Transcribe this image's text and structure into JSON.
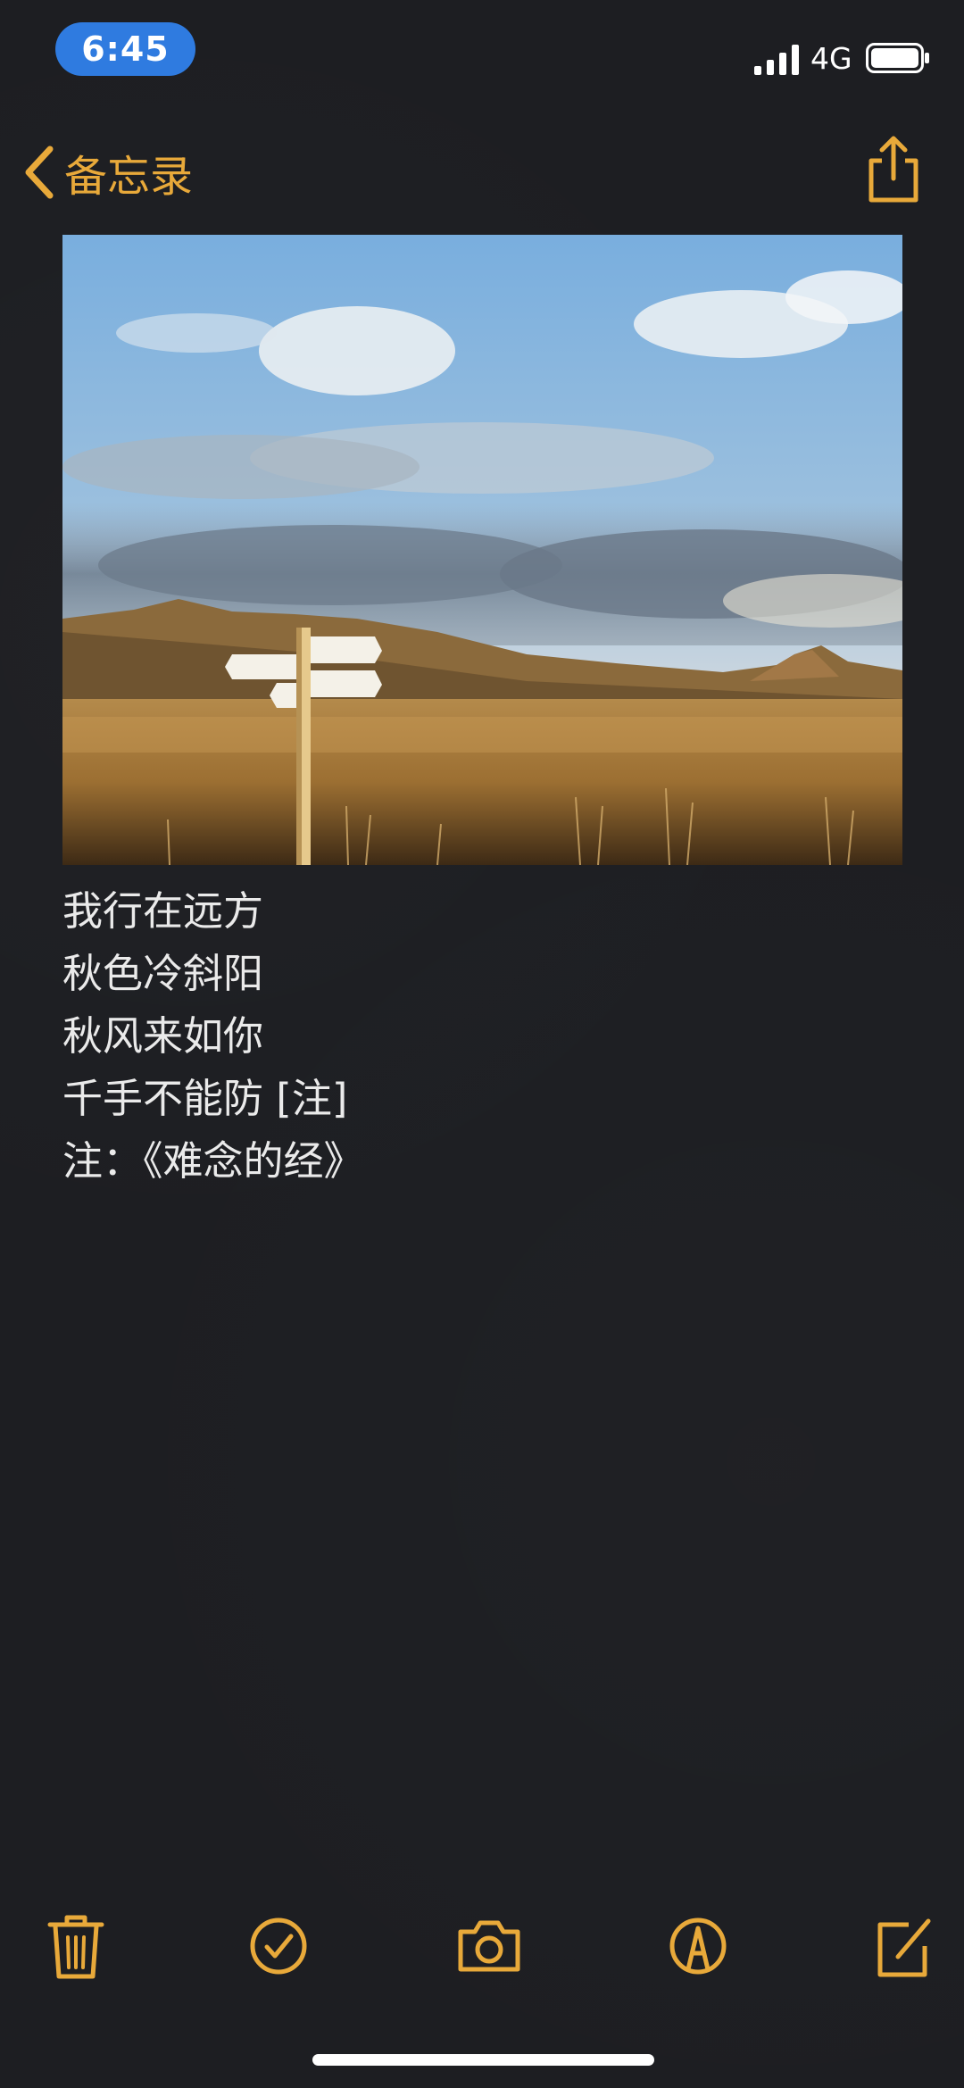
{
  "status_bar": {
    "time": "6:45",
    "network": "4G",
    "signal_icon": "cellular-signal-icon",
    "battery_icon": "battery-icon"
  },
  "nav": {
    "back_label": "备忘录",
    "back_icon": "chevron-left-icon",
    "share_icon": "share-icon"
  },
  "note": {
    "image_icon": "landscape-photo",
    "lines": [
      "我行在远方",
      "秋色冷斜阳",
      "秋风来如你",
      "千手不能防 [注]",
      "注：《难念的经》"
    ]
  },
  "toolbar": {
    "items": [
      "trash-icon",
      "checklist-icon",
      "camera-icon",
      "markup-icon",
      "compose-icon"
    ]
  },
  "colors": {
    "accent": "#e8a93a",
    "background": "#1d1e22",
    "text": "#eaeaea",
    "time_pill": "#2f7be0"
  }
}
